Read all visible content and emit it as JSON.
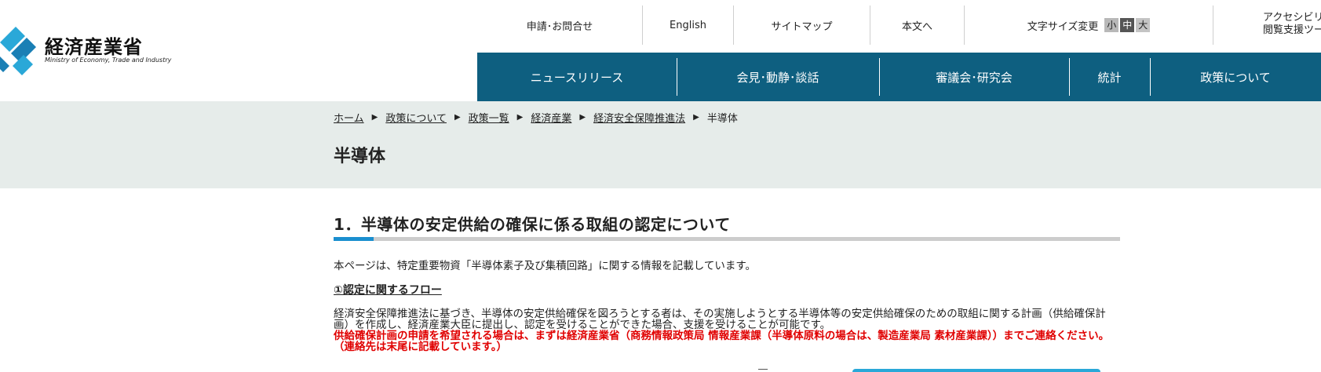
{
  "logo": {
    "name_ja": "経済産業省",
    "name_en": "Ministry of Economy, Trade and Industry",
    "colors": {
      "primary": "#1a7fb5",
      "light": "#2aa8d8"
    }
  },
  "utility_nav": {
    "contact": "申請･お問合せ",
    "english": "English",
    "sitemap": "サイトマップ",
    "skip_to_main": "本文へ",
    "font_size_label": "文字サイズ変更",
    "font_small": "小",
    "font_medium": "中",
    "font_large": "大",
    "accessibility_line1": "アクセシビリ",
    "accessibility_line2": "閲覧支援ツー"
  },
  "main_nav": {
    "color": "#0e5f80",
    "items": [
      "ニュースリリース",
      "会見･動静･談話",
      "審議会･研究会",
      "統計",
      "政策について"
    ]
  },
  "breadcrumb": {
    "links": [
      "ホーム",
      "政策について",
      "政策一覧",
      "経済産業",
      "経済安全保障推進法"
    ],
    "current": "半導体",
    "separator": "▶"
  },
  "page_title": "半導体",
  "section": {
    "heading": "1．半導体の安定供給の確保に係る取組の認定について",
    "intro": "本ページは、特定重要物資「半導体素子及び集積回路」に関する情報を記載しています。",
    "subheading": "①認定に関するフロー",
    "body": "経済安全保障推進法に基づき、半導体の安定供給確保を図ろうとする者は、その実施しようとする半導体等の安定供給確保のための取組に関する計画（供給確保計画）を作成し、経済産業大臣に提出し、認定を受けることができた場合、支援を受けることが可能です。",
    "warning": "供給確保計画の申請を希望される場合は、まずは経済産業省（商務情報政策局 情報産業課（半導体原料の場合は、製造産業局 素材産業課））までご連絡ください。（連絡先は末尾に記載しています。）",
    "warning_color": "#e00000",
    "accent_color": "#1a8fcf"
  }
}
